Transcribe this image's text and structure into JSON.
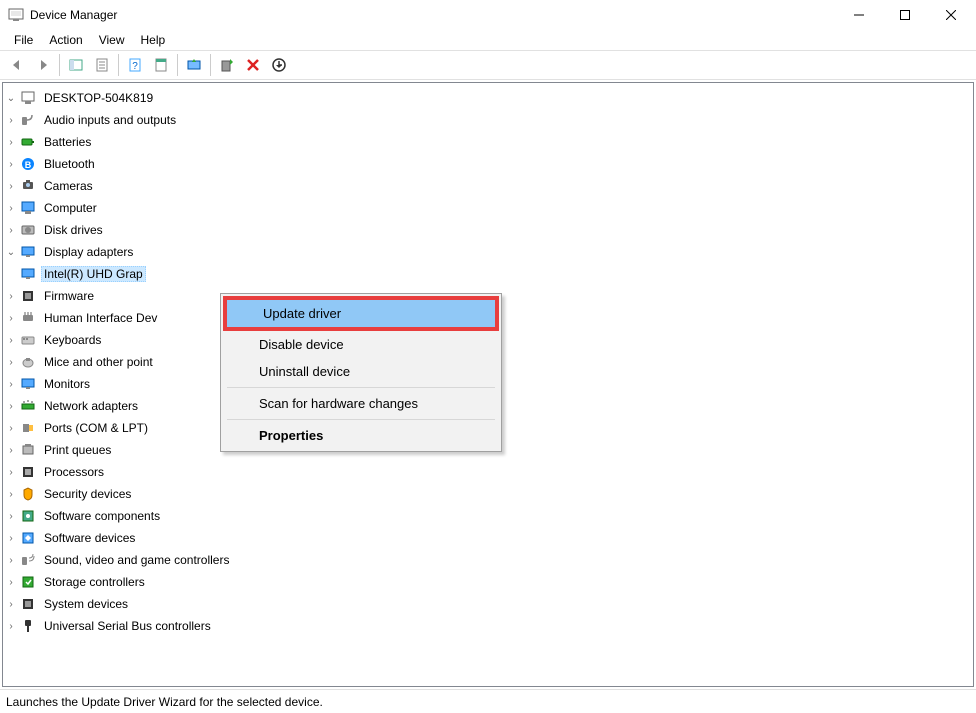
{
  "window": {
    "title": "Device Manager"
  },
  "menu": {
    "file": "File",
    "action": "Action",
    "view": "View",
    "help": "Help"
  },
  "tree": {
    "root": "DESKTOP-504K819",
    "items": [
      "Audio inputs and outputs",
      "Batteries",
      "Bluetooth",
      "Cameras",
      "Computer",
      "Disk drives",
      "Display adapters",
      "Firmware",
      "Human Interface Dev",
      "Keyboards",
      "Mice and other point",
      "Monitors",
      "Network adapters",
      "Ports (COM & LPT)",
      "Print queues",
      "Processors",
      "Security devices",
      "Software components",
      "Software devices",
      "Sound, video and game controllers",
      "Storage controllers",
      "System devices",
      "Universal Serial Bus controllers"
    ],
    "selected_child": "Intel(R) UHD Grap"
  },
  "context_menu": {
    "update": "Update driver",
    "disable": "Disable device",
    "uninstall": "Uninstall device",
    "scan": "Scan for hardware changes",
    "properties": "Properties"
  },
  "status": "Launches the Update Driver Wizard for the selected device."
}
